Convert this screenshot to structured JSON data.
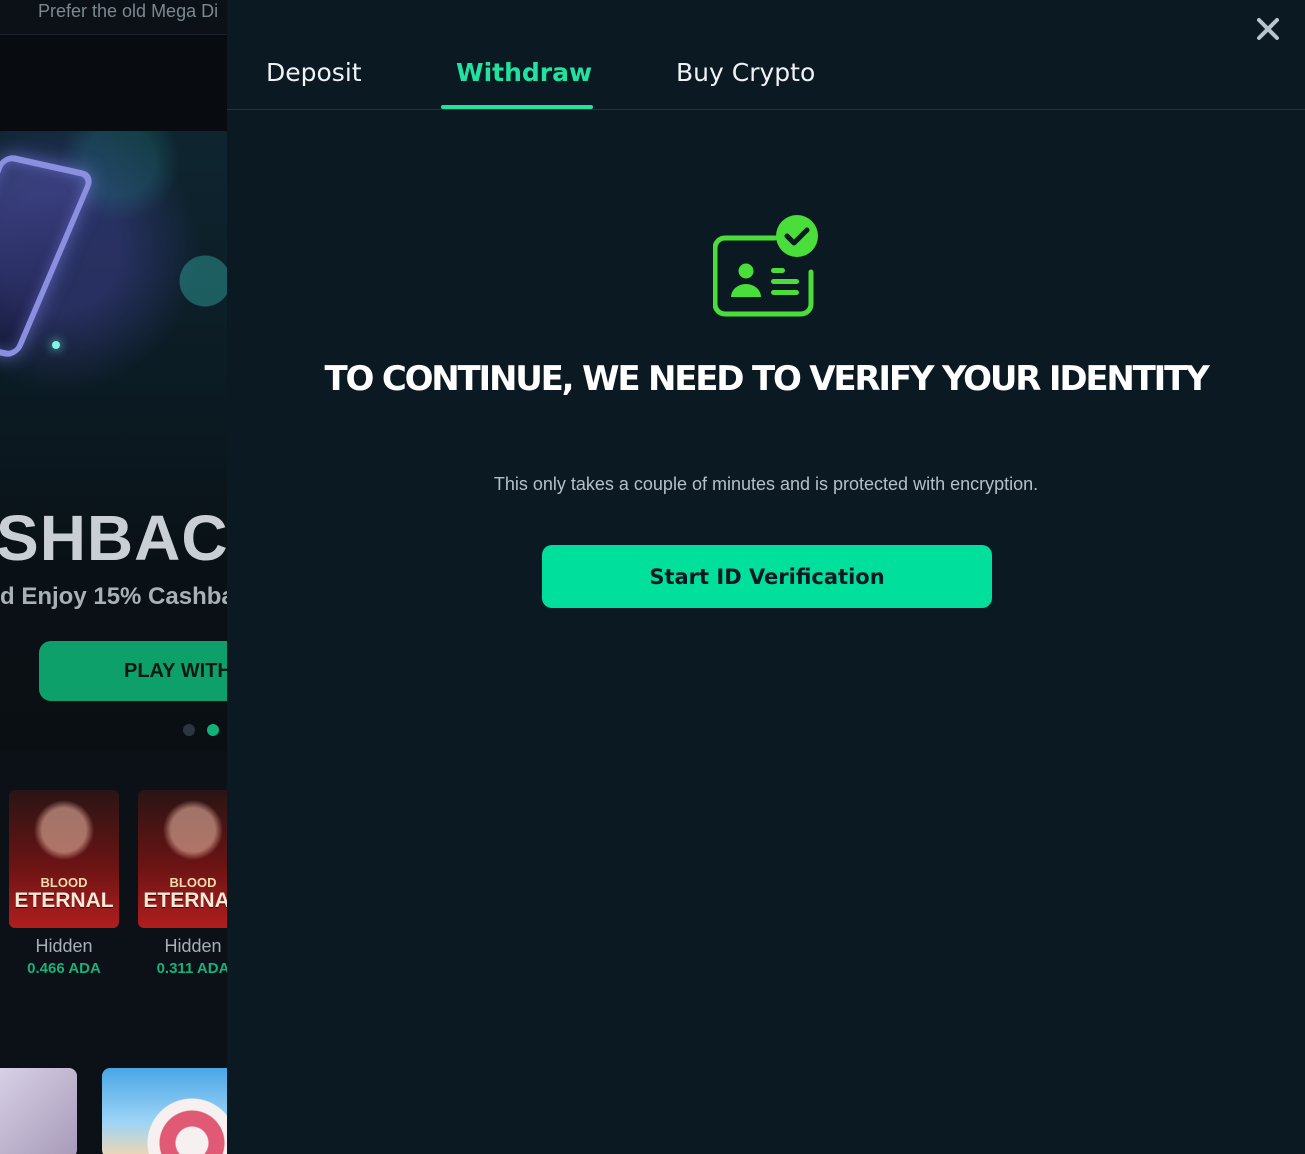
{
  "background": {
    "top_note": "Prefer the old Mega Di",
    "banner": {
      "headline": "SHBAC",
      "subtext": "d Enjoy 15% Cashba",
      "cta_label": "PLAY WITH"
    },
    "carousel_dots": 2,
    "carousel_active_index": 1,
    "games": [
      {
        "title_top": "BLOOD",
        "title_main": "ETERNAL",
        "name": "Hidden",
        "amount": "0.466 ADA"
      },
      {
        "title_top": "BLOOD",
        "title_main": "ETERNAL",
        "name": "Hidden",
        "amount": "0.311 ADA"
      }
    ]
  },
  "modal": {
    "tabs": [
      {
        "label": "Deposit",
        "active": false
      },
      {
        "label": "Withdraw",
        "active": true
      },
      {
        "label": "Buy Crypto",
        "active": false
      }
    ],
    "icon": "id-card-check-icon",
    "title": "TO CONTINUE, WE NEED TO VERIFY YOUR IDENTITY",
    "subtitle": "This only takes a couple of minutes and is protected with encryption.",
    "button_label": "Start ID Verification",
    "close_icon": "close-icon"
  },
  "colors": {
    "accent": "#21e3a0",
    "button": "#00e09c",
    "icon_green": "#4ade3a",
    "modal_bg": "#0b1923"
  }
}
